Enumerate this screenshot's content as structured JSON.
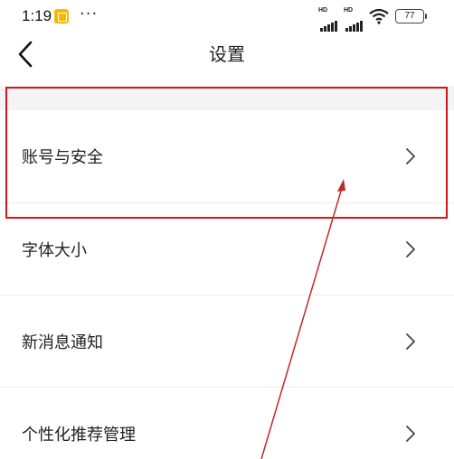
{
  "status_bar": {
    "time": "1:19",
    "more": "···",
    "signal_label": "HD",
    "battery": "77"
  },
  "nav": {
    "title": "设置"
  },
  "settings": {
    "items": [
      {
        "label": "账号与安全",
        "icon": "chevron-right-icon"
      },
      {
        "label": "字体大小",
        "icon": "chevron-right-icon"
      },
      {
        "label": "新消息通知",
        "icon": "chevron-right-icon"
      },
      {
        "label": "个性化推荐管理",
        "icon": "chevron-right-icon"
      }
    ]
  },
  "annotation": {
    "highlight_color": "#d8141b",
    "arrow_color": "#c0282c"
  }
}
